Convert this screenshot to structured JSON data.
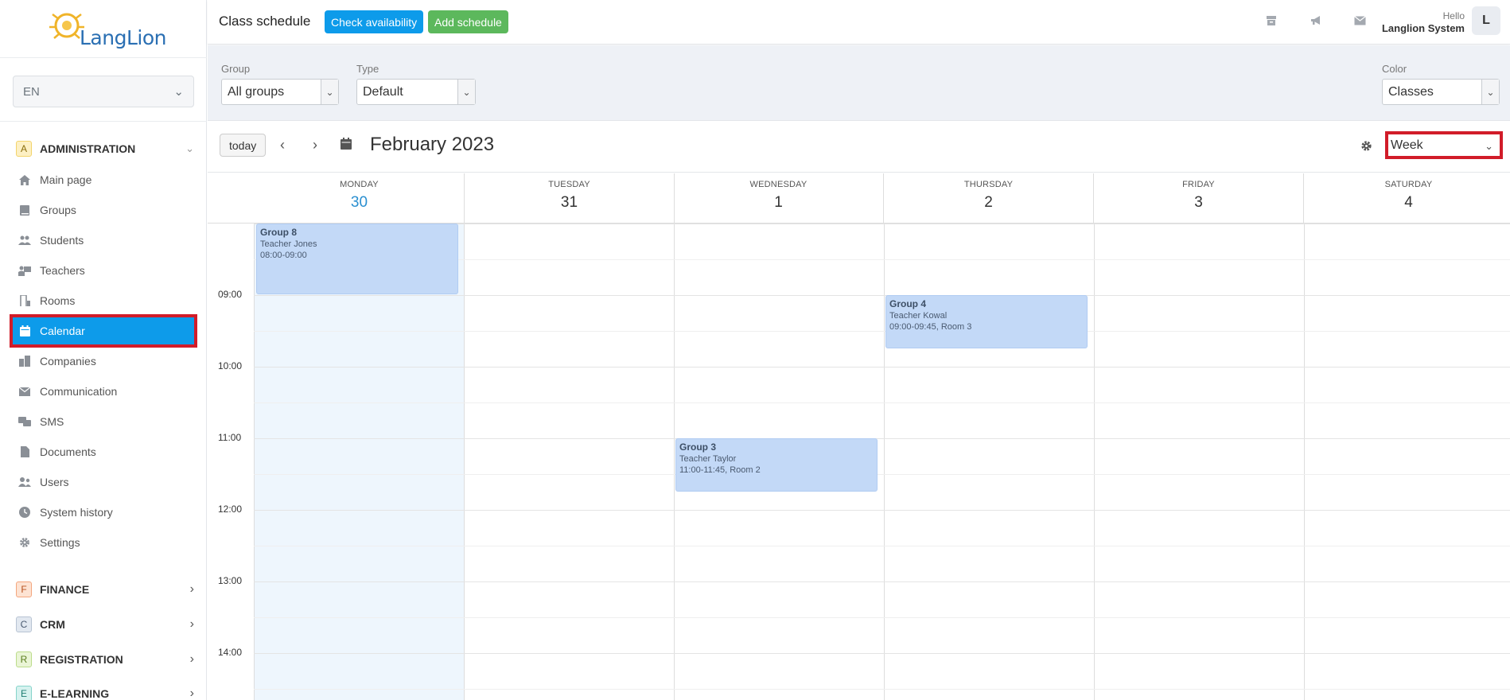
{
  "app": {
    "logo_text": "LangLion"
  },
  "language": {
    "value": "EN"
  },
  "sections": {
    "administration": {
      "letter": "A",
      "title": "ADMINISTRATION"
    },
    "finance": {
      "letter": "F",
      "title": "FINANCE"
    },
    "crm": {
      "letter": "C",
      "title": "CRM"
    },
    "registration": {
      "letter": "R",
      "title": "REGISTRATION"
    },
    "elearning": {
      "letter": "E",
      "title": "E-LEARNING"
    }
  },
  "nav": [
    {
      "label": "Main page",
      "icon": "home-icon"
    },
    {
      "label": "Groups",
      "icon": "book-icon"
    },
    {
      "label": "Students",
      "icon": "students-icon"
    },
    {
      "label": "Teachers",
      "icon": "teacher-icon"
    },
    {
      "label": "Rooms",
      "icon": "door-icon"
    },
    {
      "label": "Calendar",
      "icon": "calendar-icon",
      "active": true
    },
    {
      "label": "Companies",
      "icon": "building-icon"
    },
    {
      "label": "Communication",
      "icon": "envelope-icon"
    },
    {
      "label": "SMS",
      "icon": "sms-icon"
    },
    {
      "label": "Documents",
      "icon": "document-icon"
    },
    {
      "label": "Users",
      "icon": "users-icon"
    },
    {
      "label": "System history",
      "icon": "clock-icon"
    },
    {
      "label": "Settings",
      "icon": "gear-icon"
    }
  ],
  "header": {
    "title": "Class schedule",
    "check_label": "Check availability",
    "add_label": "Add schedule",
    "hello": "Hello",
    "user_name": "Langlion System",
    "avatar_letter": "L"
  },
  "filters": {
    "group": {
      "label": "Group",
      "value": "All groups"
    },
    "type": {
      "label": "Type",
      "value": "Default"
    },
    "color": {
      "label": "Color",
      "value": "Classes"
    }
  },
  "calendar": {
    "today_label": "today",
    "title": "February 2023",
    "view": "Week",
    "days": [
      {
        "name": "MONDAY",
        "num": "30",
        "today": true
      },
      {
        "name": "TUESDAY",
        "num": "31"
      },
      {
        "name": "WEDNESDAY",
        "num": "1"
      },
      {
        "name": "THURSDAY",
        "num": "2"
      },
      {
        "name": "FRIDAY",
        "num": "3"
      },
      {
        "name": "SATURDAY",
        "num": "4"
      }
    ],
    "times": [
      "09:00",
      "10:00",
      "11:00",
      "12:00",
      "13:00",
      "14:00"
    ],
    "events": [
      {
        "title": "Group 8",
        "teacher": "Teacher Jones",
        "detail": "08:00-09:00"
      },
      {
        "title": "Group 4",
        "teacher": "Teacher Kowal",
        "detail": "09:00-09:45, Room 3"
      },
      {
        "title": "Group 3",
        "teacher": "Teacher Taylor",
        "detail": "11:00-11:45, Room 2"
      }
    ]
  },
  "colors": {
    "primary": "#0d9bea",
    "success": "#5cb85c",
    "highlight": "#d11c29",
    "event": "#c3d9f7",
    "today_column": "#eef6fd"
  }
}
